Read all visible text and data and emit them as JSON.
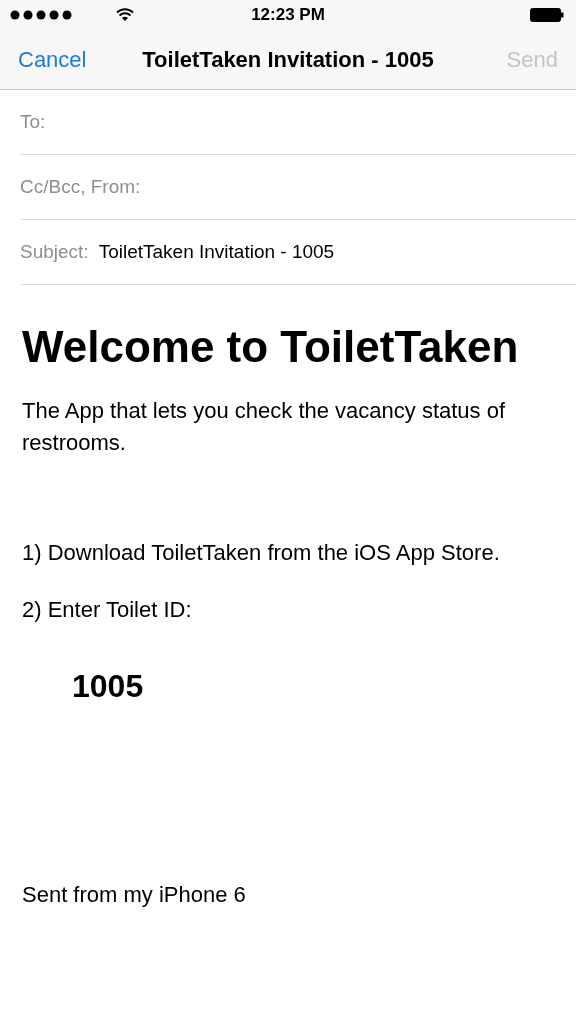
{
  "status_bar": {
    "time": "12:23 PM"
  },
  "nav_bar": {
    "cancel": "Cancel",
    "title": "ToiletTaken Invitation - 1005",
    "send": {
      "label": "Send",
      "disabled": true
    }
  },
  "fields": [
    {
      "label": "To:"
    },
    {
      "label": "Cc/Bcc, From:"
    },
    {
      "label": "Subject:",
      "value": "ToiletTaken Invitation - 1005"
    }
  ],
  "body": {
    "heading": "Welcome to ToiletTaken",
    "intro": "The App that lets you check the vacancy status of restrooms.",
    "steps": [
      "1) Download ToiletTaken from the iOS App Store.",
      "2) Enter Toilet ID:"
    ],
    "toilet_id": "1005",
    "signature": "Sent from my iPhone 6"
  }
}
